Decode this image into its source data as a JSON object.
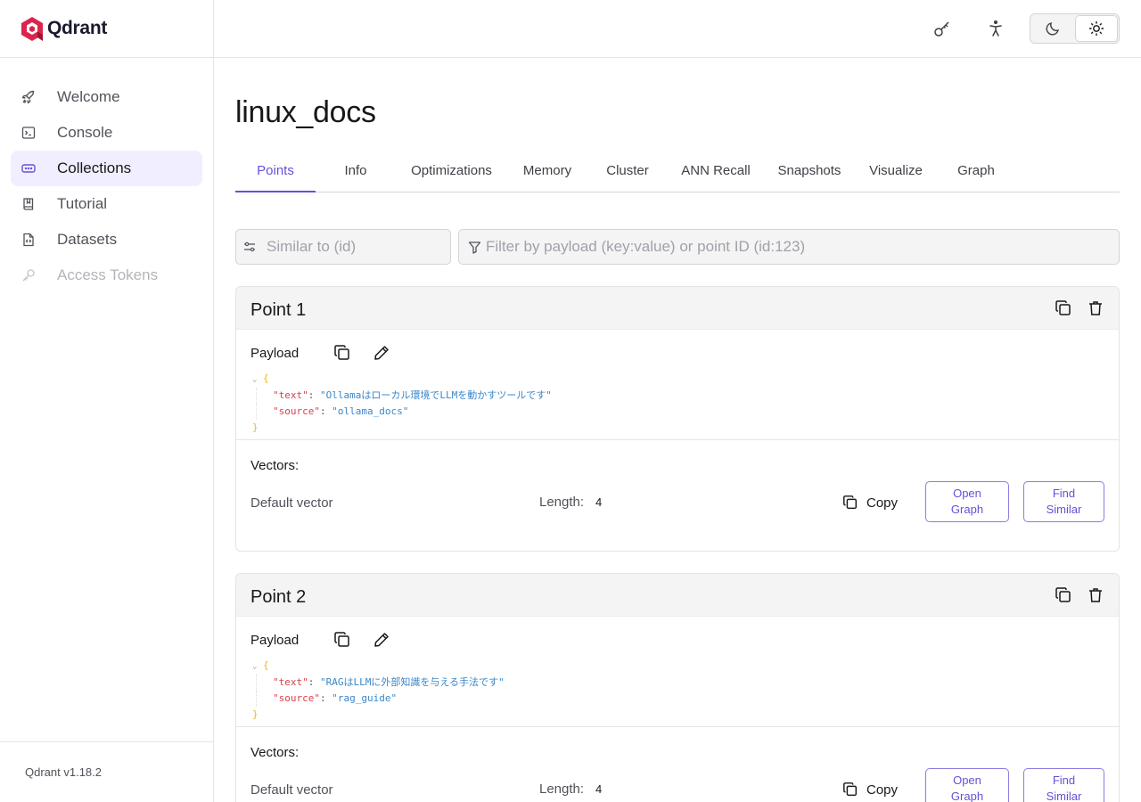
{
  "app": {
    "logo_text": "Qdrant",
    "brand_color": "#dc244c",
    "accent_color": "#6750d8",
    "version": "Qdrant v1.18.2"
  },
  "sidebar": {
    "items": [
      {
        "label": "Welcome",
        "icon": "rocket-icon",
        "active": false,
        "disabled": false
      },
      {
        "label": "Console",
        "icon": "terminal-icon",
        "active": false,
        "disabled": false
      },
      {
        "label": "Collections",
        "icon": "collections-icon",
        "active": true,
        "disabled": false
      },
      {
        "label": "Tutorial",
        "icon": "book-icon",
        "active": false,
        "disabled": false
      },
      {
        "label": "Datasets",
        "icon": "file-code-icon",
        "active": false,
        "disabled": false
      },
      {
        "label": "Access Tokens",
        "icon": "key-icon",
        "active": false,
        "disabled": true
      }
    ]
  },
  "topbar": {
    "icons": [
      "key-icon",
      "accessibility-icon"
    ],
    "theme": {
      "options": [
        "moon-icon",
        "sun-icon"
      ],
      "selected": "light"
    }
  },
  "main": {
    "title": "linux_docs",
    "tabs": [
      {
        "label": "Points",
        "active": true
      },
      {
        "label": "Info",
        "active": false
      },
      {
        "label": "Optimizations",
        "active": false
      },
      {
        "label": "Memory",
        "active": false
      },
      {
        "label": "Cluster",
        "active": false
      },
      {
        "label": "ANN Recall",
        "active": false
      },
      {
        "label": "Snapshots",
        "active": false
      },
      {
        "label": "Visualize",
        "active": false
      },
      {
        "label": "Graph",
        "active": false
      }
    ],
    "similar_input": {
      "placeholder": "Similar to (id)",
      "value": ""
    },
    "filter_input": {
      "placeholder": "Filter by payload (key:value) or point ID (id:123)",
      "value": ""
    }
  },
  "points": [
    {
      "title": "Point 1",
      "payload_label": "Payload",
      "payload": [
        {
          "key": "\"text\"",
          "value": "\"Ollamaはローカル環境でLLMを動かすツールです\""
        },
        {
          "key": "\"source\"",
          "value": "\"ollama_docs\""
        }
      ],
      "vectors_label": "Vectors:",
      "vector_name": "Default vector",
      "length_label": "Length:",
      "length_value": "4",
      "copy_label": "Copy",
      "open_graph_label": "Open Graph",
      "find_similar_label": "Find Similar"
    },
    {
      "title": "Point 2",
      "payload_label": "Payload",
      "payload": [
        {
          "key": "\"text\"",
          "value": "\"RAGはLLMに外部知識を与える手法です\""
        },
        {
          "key": "\"source\"",
          "value": "\"rag_guide\""
        }
      ],
      "vectors_label": "Vectors:",
      "vector_name": "Default vector",
      "length_label": "Length:",
      "length_value": "4",
      "copy_label": "Copy",
      "open_graph_label": "Open Graph",
      "find_similar_label": "Find Similar"
    }
  ]
}
